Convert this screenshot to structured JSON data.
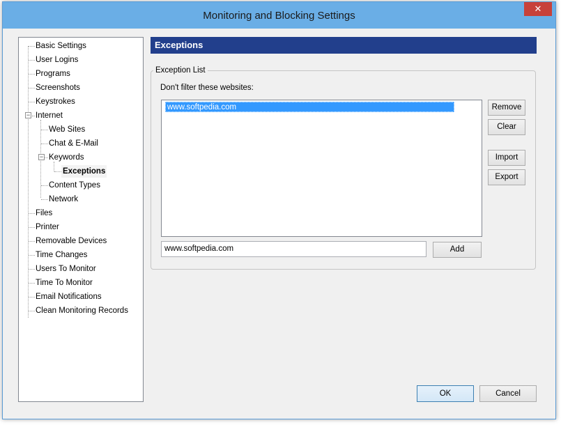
{
  "window": {
    "title": "Monitoring and Blocking Settings",
    "close_label": "✕"
  },
  "tree": {
    "items": [
      {
        "label": "Basic Settings"
      },
      {
        "label": "User Logins"
      },
      {
        "label": "Programs"
      },
      {
        "label": "Screenshots"
      },
      {
        "label": "Keystrokes"
      },
      {
        "label": "Internet",
        "expander": "−"
      },
      {
        "label": "Web Sites"
      },
      {
        "label": "Chat & E-Mail"
      },
      {
        "label": "Keywords",
        "expander": "−"
      },
      {
        "label": "Exceptions",
        "selected": true
      },
      {
        "label": "Content Types"
      },
      {
        "label": "Network"
      },
      {
        "label": "Files"
      },
      {
        "label": "Printer"
      },
      {
        "label": "Removable Devices"
      },
      {
        "label": "Time Changes"
      },
      {
        "label": "Users To Monitor"
      },
      {
        "label": "Time To Monitor"
      },
      {
        "label": "Email Notifications"
      },
      {
        "label": "Clean Monitoring Records"
      }
    ]
  },
  "panel": {
    "header": "Exceptions",
    "group_label": "Exception List",
    "description": "Don't filter these websites:",
    "list_items": [
      "www.softpedia.com"
    ],
    "input_value": "www.softpedia.com"
  },
  "buttons": {
    "remove": "Remove",
    "clear": "Clear",
    "import": "Import",
    "export": "Export",
    "add": "Add",
    "ok": "OK",
    "cancel": "Cancel"
  },
  "colors": {
    "titlebar": "#6aaee6",
    "header": "#223f8c",
    "selection": "#3399ff",
    "close": "#c7413a"
  }
}
